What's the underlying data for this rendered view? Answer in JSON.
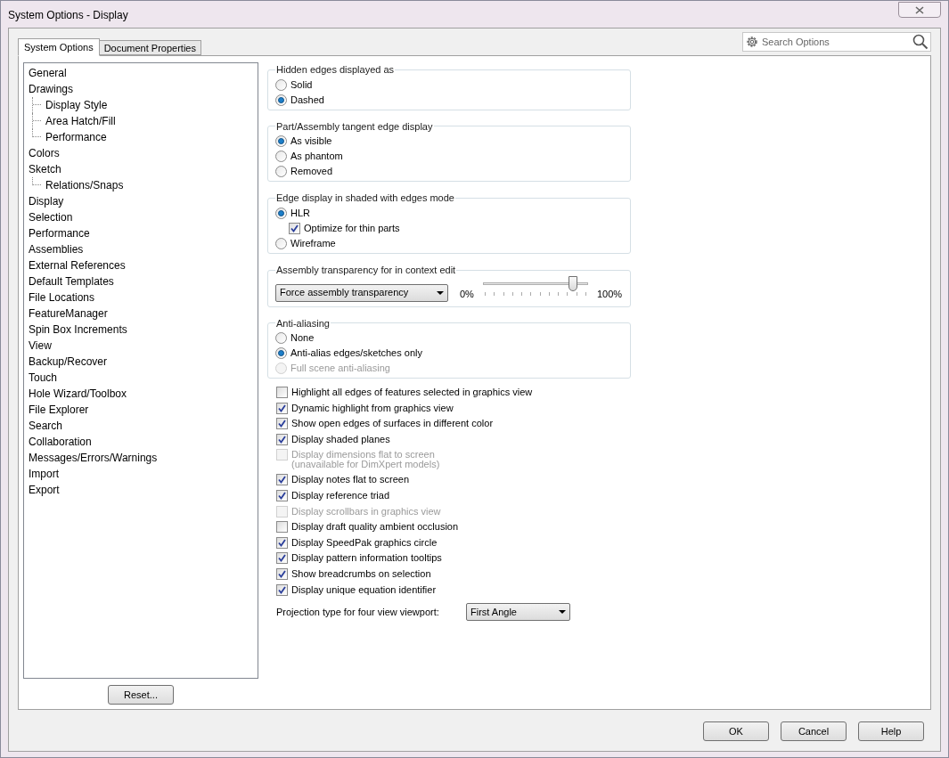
{
  "window": {
    "title": "System Options - Display"
  },
  "tabs": [
    {
      "label": "System Options",
      "selected": true
    },
    {
      "label": "Document Properties",
      "selected": false
    }
  ],
  "search": {
    "placeholder": "Search Options"
  },
  "sidebar": {
    "items": [
      {
        "label": "General"
      },
      {
        "label": "Drawings",
        "children": [
          {
            "label": "Display Style"
          },
          {
            "label": "Area Hatch/Fill"
          },
          {
            "label": "Performance"
          }
        ]
      },
      {
        "label": "Colors"
      },
      {
        "label": "Sketch",
        "children": [
          {
            "label": "Relations/Snaps"
          }
        ]
      },
      {
        "label": "Display"
      },
      {
        "label": "Selection"
      },
      {
        "label": "Performance"
      },
      {
        "label": "Assemblies"
      },
      {
        "label": "External References"
      },
      {
        "label": "Default Templates"
      },
      {
        "label": "File Locations"
      },
      {
        "label": "FeatureManager"
      },
      {
        "label": "Spin Box Increments"
      },
      {
        "label": "View"
      },
      {
        "label": "Backup/Recover"
      },
      {
        "label": "Touch"
      },
      {
        "label": "Hole Wizard/Toolbox"
      },
      {
        "label": "File Explorer"
      },
      {
        "label": "Search"
      },
      {
        "label": "Collaboration"
      },
      {
        "label": "Messages/Errors/Warnings"
      },
      {
        "label": "Import"
      },
      {
        "label": "Export"
      }
    ],
    "reset_button": "Reset..."
  },
  "groups": [
    {
      "title": "Hidden edges displayed as",
      "kind": "radios",
      "items": [
        {
          "kind": "radio",
          "label": "Solid",
          "selected": false,
          "disabled": false
        },
        {
          "kind": "radio",
          "label": "Dashed",
          "selected": true,
          "disabled": false
        }
      ]
    },
    {
      "title": "Part/Assembly tangent edge display",
      "kind": "radios",
      "items": [
        {
          "kind": "radio",
          "label": "As visible",
          "selected": true,
          "disabled": false
        },
        {
          "kind": "radio",
          "label": "As phantom",
          "selected": false,
          "disabled": false
        },
        {
          "kind": "radio",
          "label": "Removed",
          "selected": false,
          "disabled": false
        }
      ]
    },
    {
      "title": "Edge display in shaded with edges mode",
      "kind": "radios",
      "items": [
        {
          "kind": "radio",
          "label": "HLR",
          "selected": true,
          "disabled": false,
          "children": [
            {
              "kind": "checkbox",
              "label": "Optimize for thin parts",
              "checked": true,
              "disabled": false
            }
          ]
        },
        {
          "kind": "radio",
          "label": "Wireframe",
          "selected": false,
          "disabled": false
        }
      ]
    },
    {
      "title": "Assembly transparency for in context edit",
      "kind": "transparency",
      "dropdown": "Force assembly transparency",
      "min_label": "0%",
      "max_label": "100%",
      "level": 0.86
    },
    {
      "title": "Anti-aliasing",
      "kind": "radios",
      "items": [
        {
          "kind": "radio",
          "label": "None",
          "selected": false,
          "disabled": false
        },
        {
          "kind": "radio",
          "label": "Anti-alias edges/sketches only",
          "selected": true,
          "disabled": false
        },
        {
          "kind": "radio",
          "label": "Full scene anti-aliasing",
          "selected": false,
          "disabled": true
        }
      ]
    }
  ],
  "checks": [
    {
      "label": "Highlight all edges of features selected in graphics view",
      "checked": false,
      "disabled": false
    },
    {
      "label": "Dynamic highlight from graphics view",
      "checked": true,
      "disabled": false
    },
    {
      "label": "Show open edges of surfaces in different color",
      "checked": true,
      "disabled": false
    },
    {
      "label": "Display shaded planes",
      "checked": true,
      "disabled": false
    },
    {
      "label": "Display dimensions flat to screen",
      "note": "(unavailable for DimXpert models)",
      "checked": false,
      "disabled": true
    },
    {
      "label": "Display notes flat to screen",
      "checked": true,
      "disabled": false
    },
    {
      "label": "Display reference triad",
      "checked": true,
      "disabled": false
    },
    {
      "label": "Display scrollbars in graphics view",
      "checked": false,
      "disabled": true
    },
    {
      "label": "Display draft quality ambient occlusion",
      "checked": false,
      "disabled": false
    },
    {
      "label": "Display SpeedPak graphics circle",
      "checked": true,
      "disabled": false
    },
    {
      "label": "Display pattern information tooltips",
      "checked": true,
      "disabled": false
    },
    {
      "label": "Show breadcrumbs on selection",
      "checked": true,
      "disabled": false
    },
    {
      "label": "Display unique equation identifier",
      "checked": true,
      "disabled": false
    }
  ],
  "projection": {
    "label": "Projection type for four view viewport:",
    "value": "First Angle"
  },
  "buttons": [
    "OK",
    "Cancel",
    "Help"
  ]
}
